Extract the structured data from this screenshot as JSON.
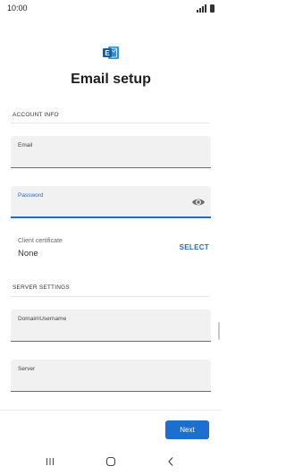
{
  "status_bar": {
    "time": "10:00",
    "icons": [
      "signal-icon",
      "battery-icon"
    ]
  },
  "header": {
    "app_icon": "exchange-logo-icon",
    "title": "Email setup"
  },
  "account_info": {
    "section_title": "ACCOUNT INFO",
    "email_label": "Email",
    "email_value": "",
    "password_label": "Password",
    "password_value": "",
    "password_toggle_icon": "eye-icon",
    "client_certificate_label": "Client certificate",
    "client_certificate_value": "None",
    "select_label": "SELECT"
  },
  "server_settings": {
    "section_title": "SERVER SETTINGS",
    "domain_username_label": "Domain\\Username",
    "domain_username_value": "",
    "server_label": "Server",
    "server_value": ""
  },
  "footer": {
    "next_label": "Next"
  },
  "nav_bar": {
    "buttons": [
      "recent-apps-icon",
      "home-icon",
      "back-icon"
    ]
  },
  "colors": {
    "accent": "#1b6fd1",
    "field_background": "#f1f1f1"
  }
}
